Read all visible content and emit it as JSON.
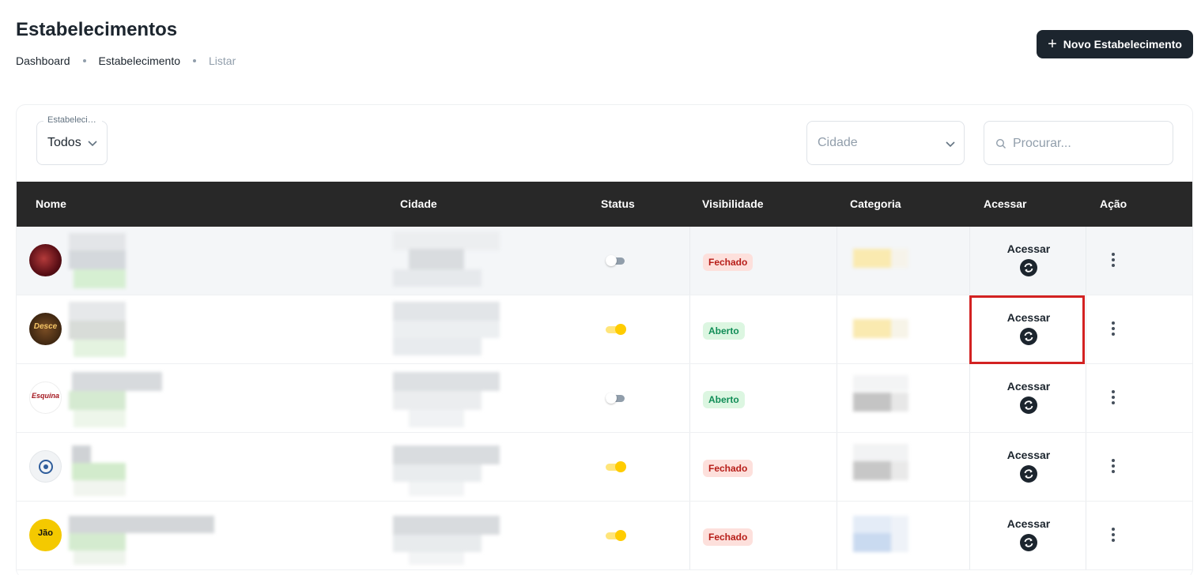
{
  "page": {
    "title": "Estabelecimentos",
    "breadcrumb": [
      "Dashboard",
      "Estabelecimento",
      "Listar"
    ]
  },
  "new_button": {
    "label": "Novo Estabelecimento",
    "icon": "plus-icon"
  },
  "filters": {
    "type": {
      "legend": "Estabelecimento",
      "value": "Todos"
    },
    "city": {
      "placeholder": "Cidade"
    },
    "search": {
      "placeholder": "Procurar..."
    }
  },
  "table": {
    "columns": [
      "Nome",
      "Cidade",
      "Status",
      "Visibilidade",
      "Categoria",
      "Acessar",
      "Ação"
    ],
    "rows": [
      {
        "avatar": "red-logo",
        "status_on": false,
        "visibility": "Fechado",
        "access_label": "Acessar"
      },
      {
        "avatar": "desce-logo",
        "avatar_text": "Desce",
        "status_on": true,
        "visibility": "Aberto",
        "access_label": "Acessar",
        "highlighted": true
      },
      {
        "avatar": "esquina-logo",
        "avatar_text": "Esquina",
        "status_on": false,
        "visibility": "Aberto",
        "access_label": "Acessar"
      },
      {
        "avatar": "blue-logo",
        "status_on": true,
        "visibility": "Fechado",
        "access_label": "Acessar"
      },
      {
        "avatar": "jao-logo",
        "avatar_text": "Jão",
        "status_on": true,
        "visibility": "Fechado",
        "access_label": "Acessar"
      }
    ]
  },
  "colors": {
    "header_bg": "#282828",
    "primary_dark": "#1c252e",
    "toggle_on": "#ffcc00",
    "badge_closed_text": "#b71d18",
    "badge_open_text": "#118d57",
    "highlight_border": "#d32222"
  }
}
